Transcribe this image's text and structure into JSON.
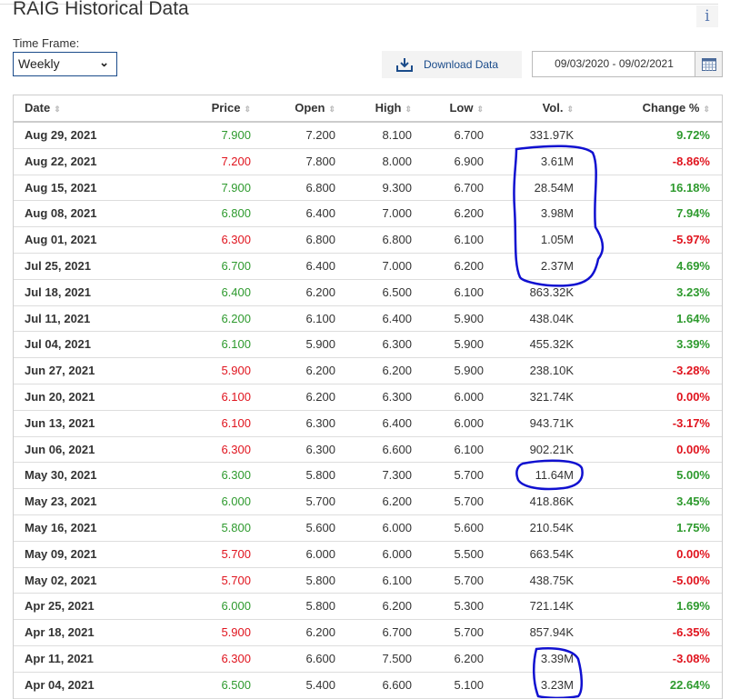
{
  "header": {
    "title": "RAIG Historical Data",
    "info_icon": "i"
  },
  "controls": {
    "time_frame_label": "Time Frame:",
    "time_frame_value": "Weekly",
    "download_label": "Download Data",
    "date_range": "09/03/2020 - 09/02/2021"
  },
  "colors": {
    "up": "#2e9a2e",
    "down": "#e0141e",
    "link": "#1a4b8a",
    "annotation": "#1010d0"
  },
  "table": {
    "columns": [
      "Date",
      "Price",
      "Open",
      "High",
      "Low",
      "Vol.",
      "Change %"
    ],
    "rows": [
      {
        "date": "Aug 29, 2021",
        "price": "7.900",
        "open": "7.200",
        "high": "8.100",
        "low": "6.700",
        "vol": "331.97K",
        "chg": "9.72%",
        "dir": "up"
      },
      {
        "date": "Aug 22, 2021",
        "price": "7.200",
        "open": "7.800",
        "high": "8.000",
        "low": "6.900",
        "vol": "3.61M",
        "chg": "-8.86%",
        "dir": "down"
      },
      {
        "date": "Aug 15, 2021",
        "price": "7.900",
        "open": "6.800",
        "high": "9.300",
        "low": "6.700",
        "vol": "28.54M",
        "chg": "16.18%",
        "dir": "up"
      },
      {
        "date": "Aug 08, 2021",
        "price": "6.800",
        "open": "6.400",
        "high": "7.000",
        "low": "6.200",
        "vol": "3.98M",
        "chg": "7.94%",
        "dir": "up"
      },
      {
        "date": "Aug 01, 2021",
        "price": "6.300",
        "open": "6.800",
        "high": "6.800",
        "low": "6.100",
        "vol": "1.05M",
        "chg": "-5.97%",
        "dir": "down"
      },
      {
        "date": "Jul 25, 2021",
        "price": "6.700",
        "open": "6.400",
        "high": "7.000",
        "low": "6.200",
        "vol": "2.37M",
        "chg": "4.69%",
        "dir": "up"
      },
      {
        "date": "Jul 18, 2021",
        "price": "6.400",
        "open": "6.200",
        "high": "6.500",
        "low": "6.100",
        "vol": "863.32K",
        "chg": "3.23%",
        "dir": "up"
      },
      {
        "date": "Jul 11, 2021",
        "price": "6.200",
        "open": "6.100",
        "high": "6.400",
        "low": "5.900",
        "vol": "438.04K",
        "chg": "1.64%",
        "dir": "up"
      },
      {
        "date": "Jul 04, 2021",
        "price": "6.100",
        "open": "5.900",
        "high": "6.300",
        "low": "5.900",
        "vol": "455.32K",
        "chg": "3.39%",
        "dir": "up"
      },
      {
        "date": "Jun 27, 2021",
        "price": "5.900",
        "open": "6.200",
        "high": "6.200",
        "low": "5.900",
        "vol": "238.10K",
        "chg": "-3.28%",
        "dir": "down"
      },
      {
        "date": "Jun 20, 2021",
        "price": "6.100",
        "open": "6.200",
        "high": "6.300",
        "low": "6.000",
        "vol": "321.74K",
        "chg": "0.00%",
        "dir": "down"
      },
      {
        "date": "Jun 13, 2021",
        "price": "6.100",
        "open": "6.300",
        "high": "6.400",
        "low": "6.000",
        "vol": "943.71K",
        "chg": "-3.17%",
        "dir": "down"
      },
      {
        "date": "Jun 06, 2021",
        "price": "6.300",
        "open": "6.300",
        "high": "6.600",
        "low": "6.100",
        "vol": "902.21K",
        "chg": "0.00%",
        "dir": "down"
      },
      {
        "date": "May 30, 2021",
        "price": "6.300",
        "open": "5.800",
        "high": "7.300",
        "low": "5.700",
        "vol": "11.64M",
        "chg": "5.00%",
        "dir": "up"
      },
      {
        "date": "May 23, 2021",
        "price": "6.000",
        "open": "5.700",
        "high": "6.200",
        "low": "5.700",
        "vol": "418.86K",
        "chg": "3.45%",
        "dir": "up"
      },
      {
        "date": "May 16, 2021",
        "price": "5.800",
        "open": "5.600",
        "high": "6.000",
        "low": "5.600",
        "vol": "210.54K",
        "chg": "1.75%",
        "dir": "up"
      },
      {
        "date": "May 09, 2021",
        "price": "5.700",
        "open": "6.000",
        "high": "6.000",
        "low": "5.500",
        "vol": "663.54K",
        "chg": "0.00%",
        "dir": "down"
      },
      {
        "date": "May 02, 2021",
        "price": "5.700",
        "open": "5.800",
        "high": "6.100",
        "low": "5.700",
        "vol": "438.75K",
        "chg": "-5.00%",
        "dir": "down"
      },
      {
        "date": "Apr 25, 2021",
        "price": "6.000",
        "open": "5.800",
        "high": "6.200",
        "low": "5.300",
        "vol": "721.14K",
        "chg": "1.69%",
        "dir": "up"
      },
      {
        "date": "Apr 18, 2021",
        "price": "5.900",
        "open": "6.200",
        "high": "6.700",
        "low": "5.700",
        "vol": "857.94K",
        "chg": "-6.35%",
        "dir": "down"
      },
      {
        "date": "Apr 11, 2021",
        "price": "6.300",
        "open": "6.600",
        "high": "7.500",
        "low": "6.200",
        "vol": "3.39M",
        "chg": "-3.08%",
        "dir": "down"
      },
      {
        "date": "Apr 04, 2021",
        "price": "6.500",
        "open": "5.400",
        "high": "6.600",
        "low": "5.100",
        "vol": "3.23M",
        "chg": "22.64%",
        "dir": "up"
      }
    ]
  }
}
